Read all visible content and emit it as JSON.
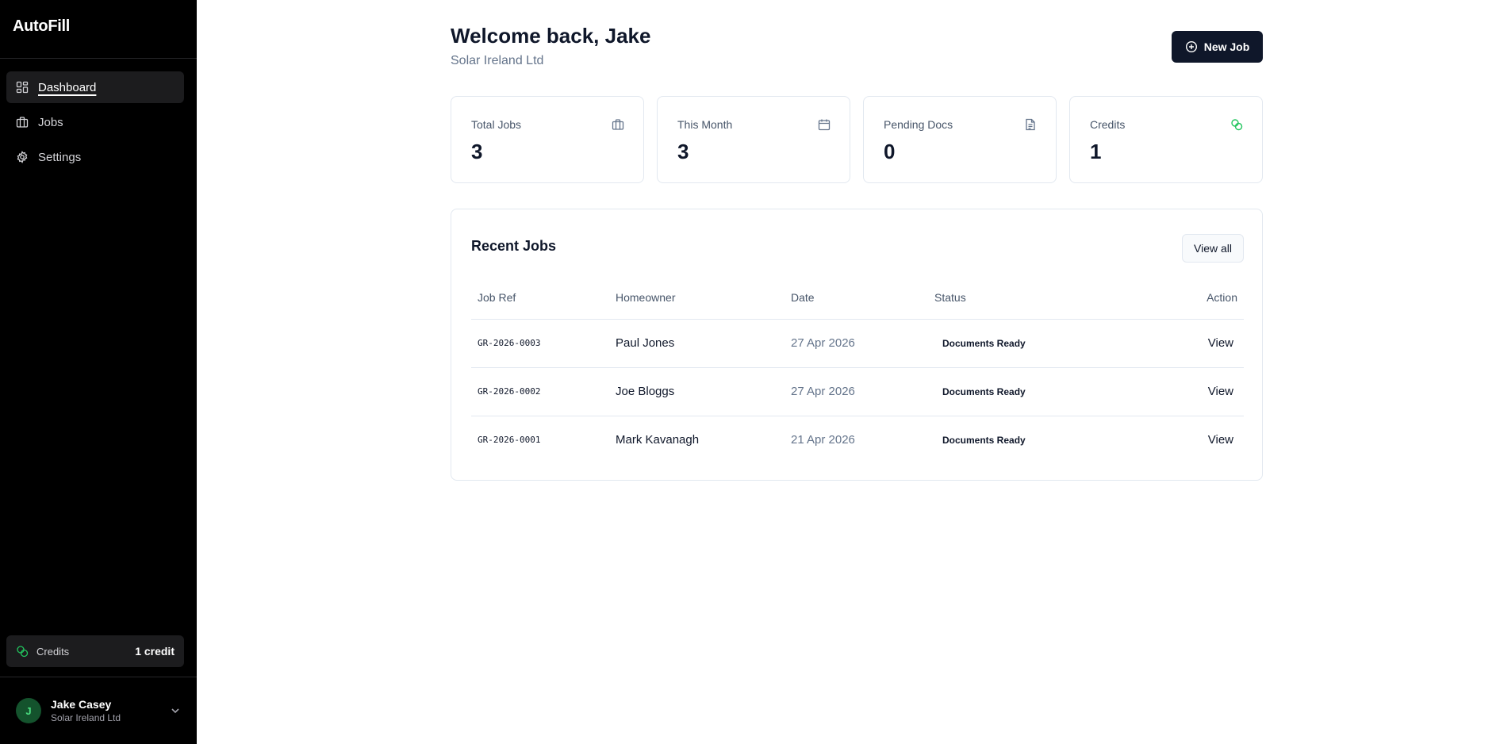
{
  "app": {
    "title": "AutoFill"
  },
  "sidebar": {
    "nav": [
      {
        "label": "Dashboard",
        "icon": "dashboard-grid-icon",
        "active": true
      },
      {
        "label": "Jobs",
        "icon": "briefcase-icon",
        "active": false
      },
      {
        "label": "Settings",
        "icon": "gear-icon",
        "active": false
      }
    ],
    "credits": {
      "label": "Credits",
      "value": "1 credit",
      "icon": "coins-icon"
    },
    "user": {
      "initial": "J",
      "name": "Jake Casey",
      "org": "Solar Ireland Ltd"
    }
  },
  "header": {
    "welcome": "Welcome back, Jake",
    "org": "Solar Ireland Ltd",
    "new_job_label": "New Job"
  },
  "stats": [
    {
      "label": "Total Jobs",
      "value": "3",
      "icon": "briefcase-icon"
    },
    {
      "label": "This Month",
      "value": "3",
      "icon": "calendar-icon"
    },
    {
      "label": "Pending Docs",
      "value": "0",
      "icon": "document-icon"
    },
    {
      "label": "Credits",
      "value": "1",
      "icon": "coins-icon"
    }
  ],
  "recent_jobs": {
    "title": "Recent Jobs",
    "view_all_label": "View all",
    "columns": [
      "Job Ref",
      "Homeowner",
      "Date",
      "Status",
      "Action"
    ],
    "rows": [
      {
        "ref": "GR-2026-0003",
        "homeowner": "Paul Jones",
        "date": "27 Apr 2026",
        "status": "Documents Ready",
        "action": "View"
      },
      {
        "ref": "GR-2026-0002",
        "homeowner": "Joe Bloggs",
        "date": "27 Apr 2026",
        "status": "Documents Ready",
        "action": "View"
      },
      {
        "ref": "GR-2026-0001",
        "homeowner": "Mark Kavanagh",
        "date": "21 Apr 2026",
        "status": "Documents Ready",
        "action": "View"
      }
    ]
  },
  "colors": {
    "sidebar_bg": "#000000",
    "primary_button": "#0f172a",
    "credits_accent": "#22c55e",
    "border": "#e2e8f0",
    "muted_text": "#64748b"
  }
}
